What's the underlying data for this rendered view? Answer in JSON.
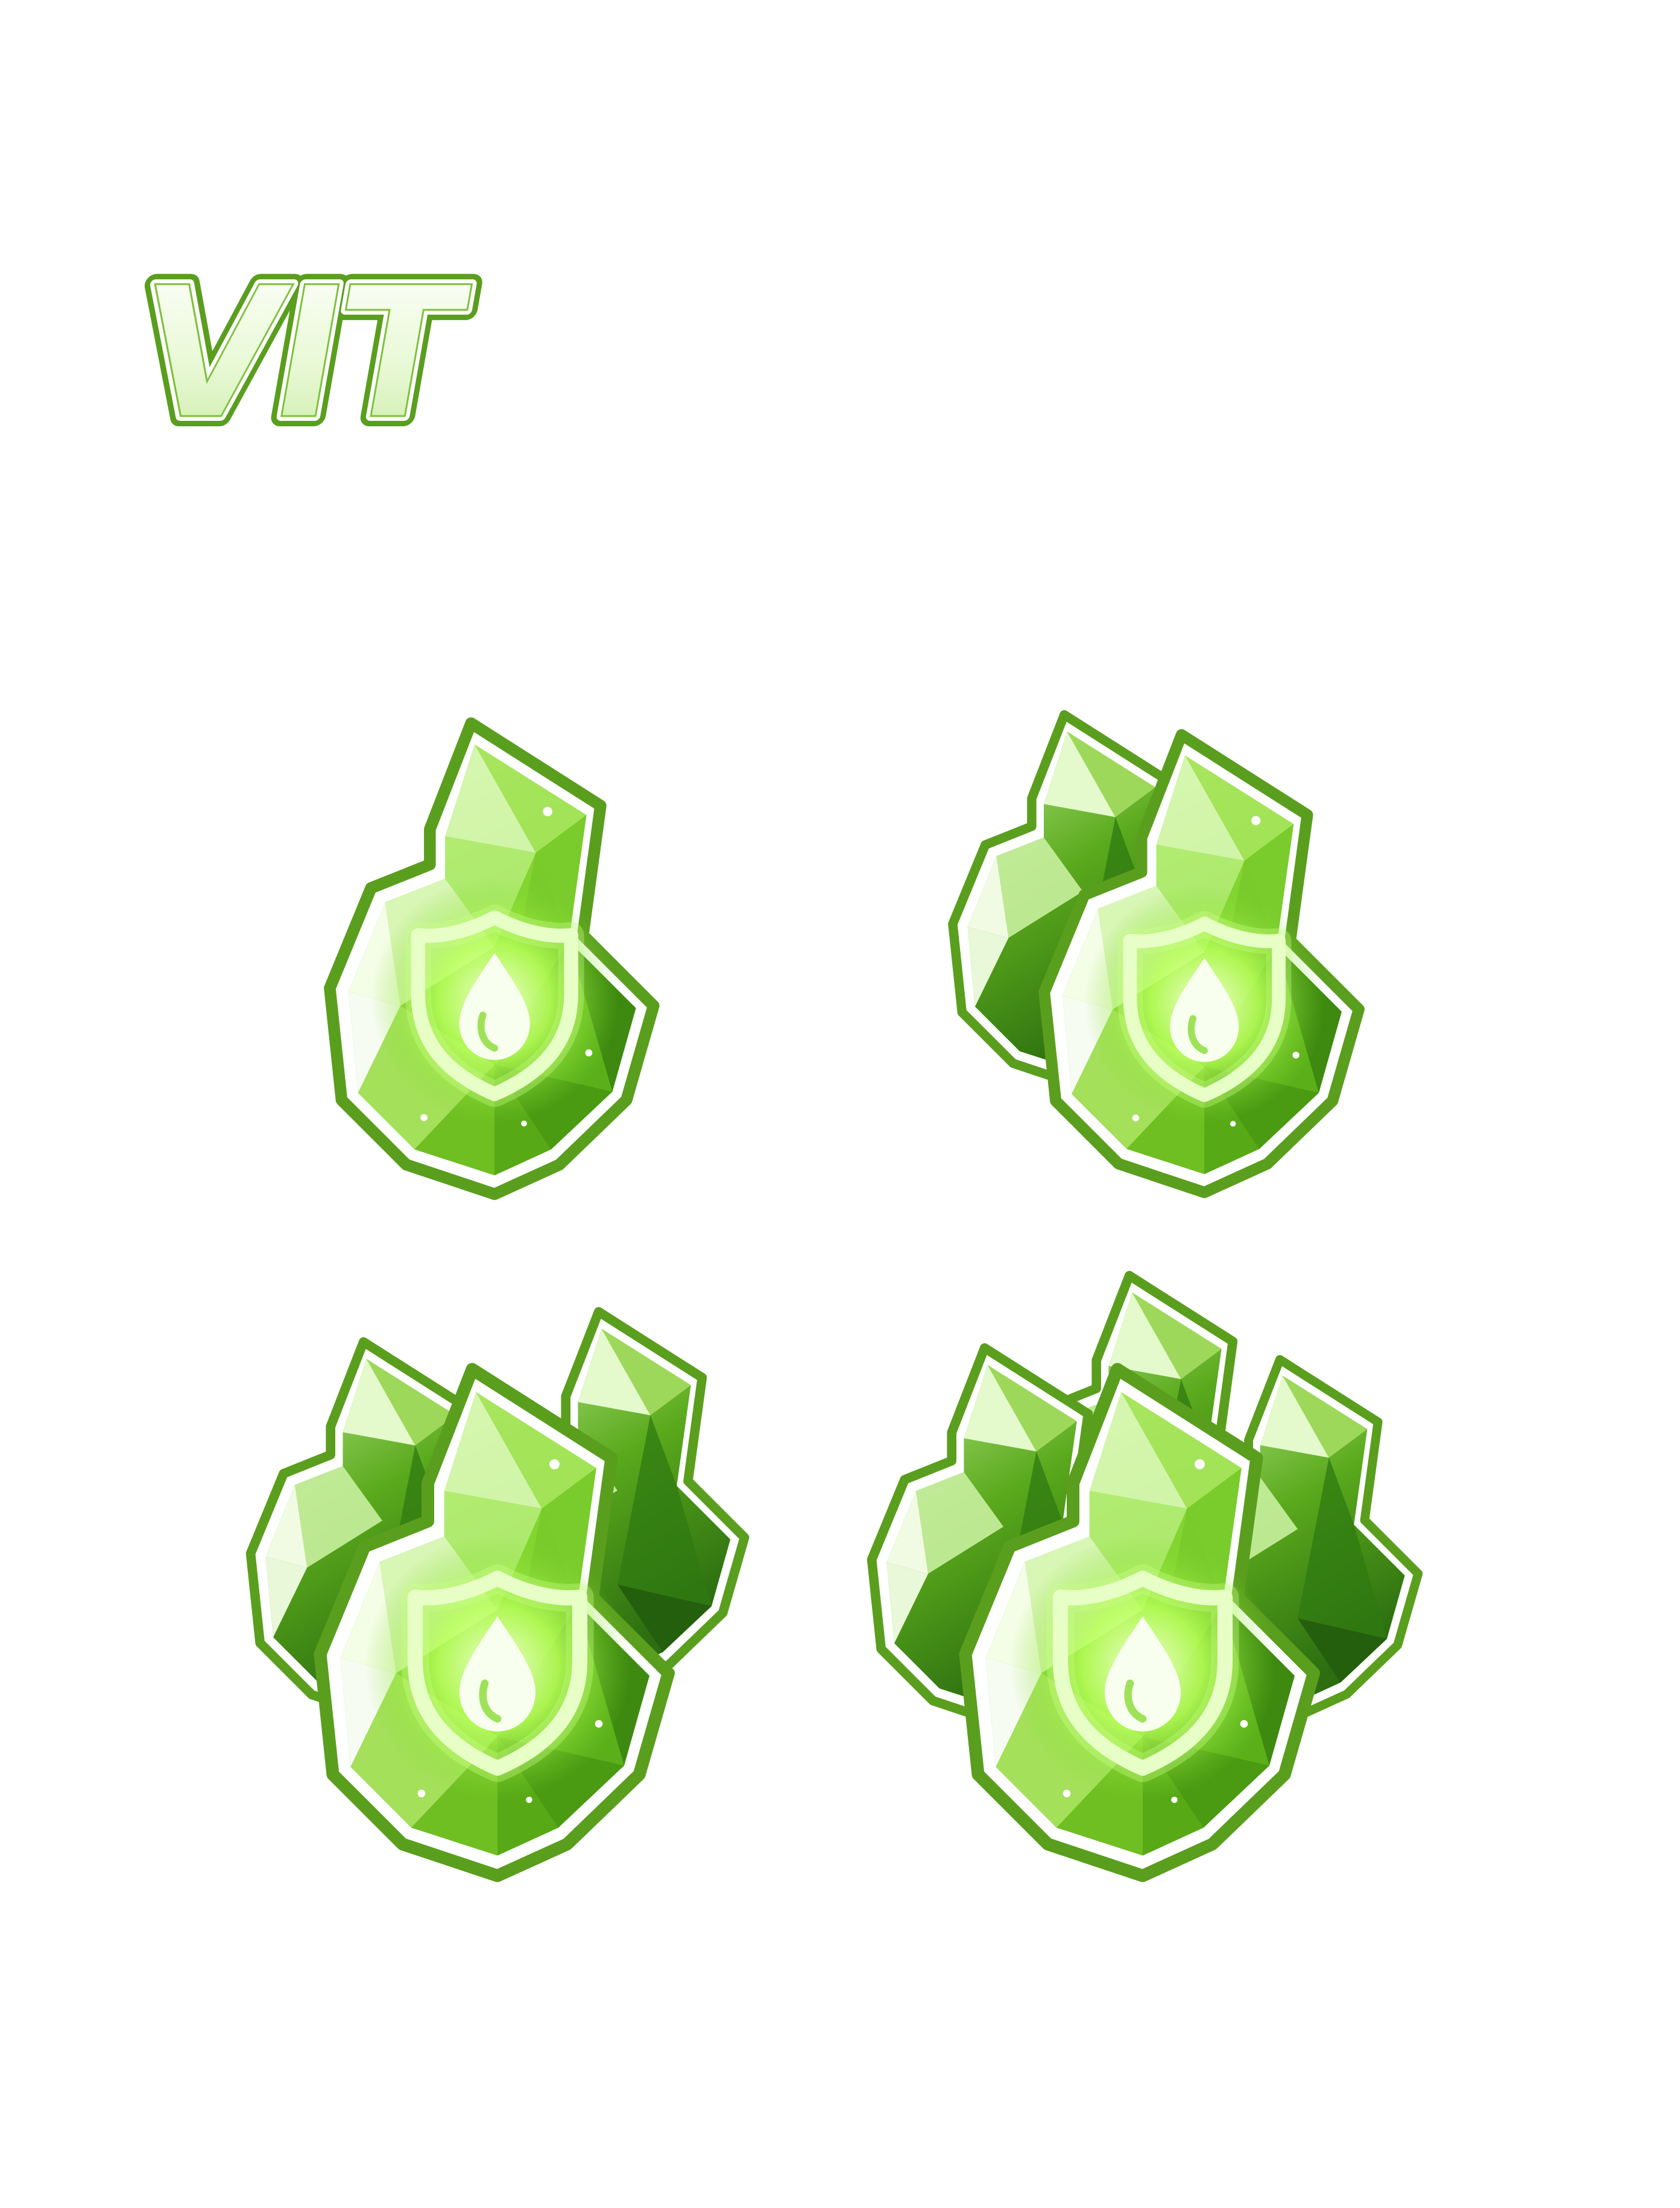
{
  "stat_label": "VIT",
  "colors": {
    "outline": "#5a9e1e",
    "gem_light": "#b8f07a",
    "gem_mid": "#6cc81c",
    "gem_dark": "#2f7a12",
    "gem_deep": "#1f5a0c",
    "glow": "#e8ffc8",
    "background": "#ffffff"
  },
  "icons": [
    {
      "id": "vit-crystal-tier-1",
      "crystals": 1,
      "emblem": "shield-droplet-icon"
    },
    {
      "id": "vit-crystal-tier-2",
      "crystals": 2,
      "emblem": "shield-droplet-icon"
    },
    {
      "id": "vit-crystal-tier-3",
      "crystals": 3,
      "emblem": "shield-droplet-icon"
    },
    {
      "id": "vit-crystal-tier-4",
      "crystals": 4,
      "emblem": "shield-droplet-icon"
    }
  ]
}
